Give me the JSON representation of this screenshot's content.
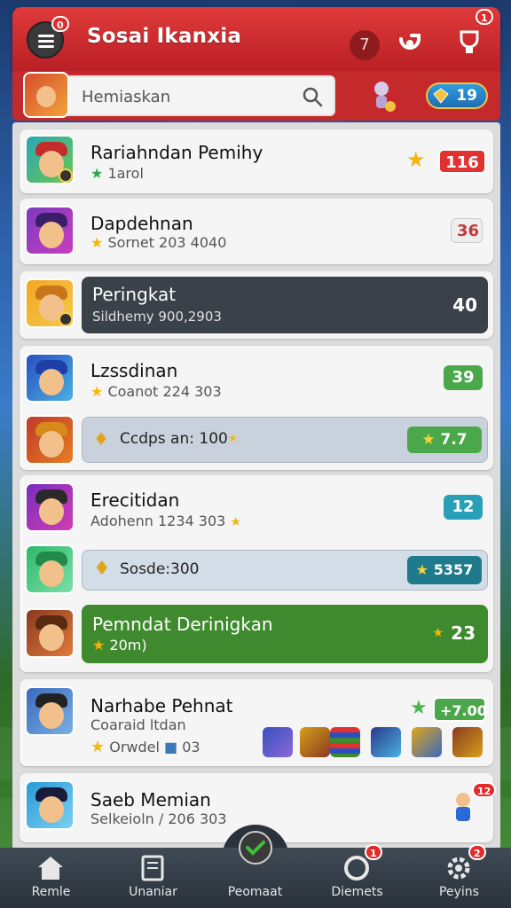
{
  "header": {
    "title": "Sosai Ikanxia",
    "menu_badge": "0",
    "counter": "7",
    "right_badge": "1"
  },
  "search": {
    "placeholder": "Hemiaskan",
    "coins": "19"
  },
  "rows": [
    {
      "title": "Rariahndan Pemihy",
      "sub": "1arol",
      "score": "116"
    },
    {
      "title": "Dapdehnan",
      "sub": "Sornet 203 4040",
      "score": "36"
    },
    {
      "title": "Peringkat",
      "sub": "Sildhemy 900,2903",
      "score": "40"
    },
    {
      "title": "Lzssdinan",
      "sub": "Coanot 224 303",
      "score": "39"
    },
    {
      "bar_text": "Ccdps an: 100",
      "score": "7.7"
    },
    {
      "title": "Erecitidan",
      "sub": "Adohenn 1234 303",
      "score": "12"
    },
    {
      "bar_text": "Sosde:300",
      "score": "5357"
    },
    {
      "title": "Pemndat Derinigkan",
      "sub": "20m)",
      "score": "23"
    },
    {
      "title": "Narhabe Pehnat",
      "sub": "Coaraid ltdan",
      "sub2": "Orwdel",
      "sub2_num": "03",
      "score": "+7.00"
    },
    {
      "title": "Saeb Memian",
      "sub": "Selkeioln / 206 303",
      "badge": "12"
    }
  ],
  "bottom_nav": [
    {
      "label": "Remle",
      "icon": "home-icon"
    },
    {
      "label": "Unaniar",
      "icon": "book-icon"
    },
    {
      "label": "Peomaat",
      "icon": "checkmark-icon"
    },
    {
      "label": "Diemets",
      "icon": "shield-icon",
      "badge": "1"
    },
    {
      "label": "Peyins",
      "icon": "gear-icon",
      "badge": "2"
    }
  ],
  "colors": {
    "header_red": "#d62f32",
    "dark_row": "#3a4149",
    "green_row": "#3f8a2f",
    "score_red": "#e23131",
    "score_green": "#4aa84a",
    "score_teal": "#1f7a8c"
  }
}
